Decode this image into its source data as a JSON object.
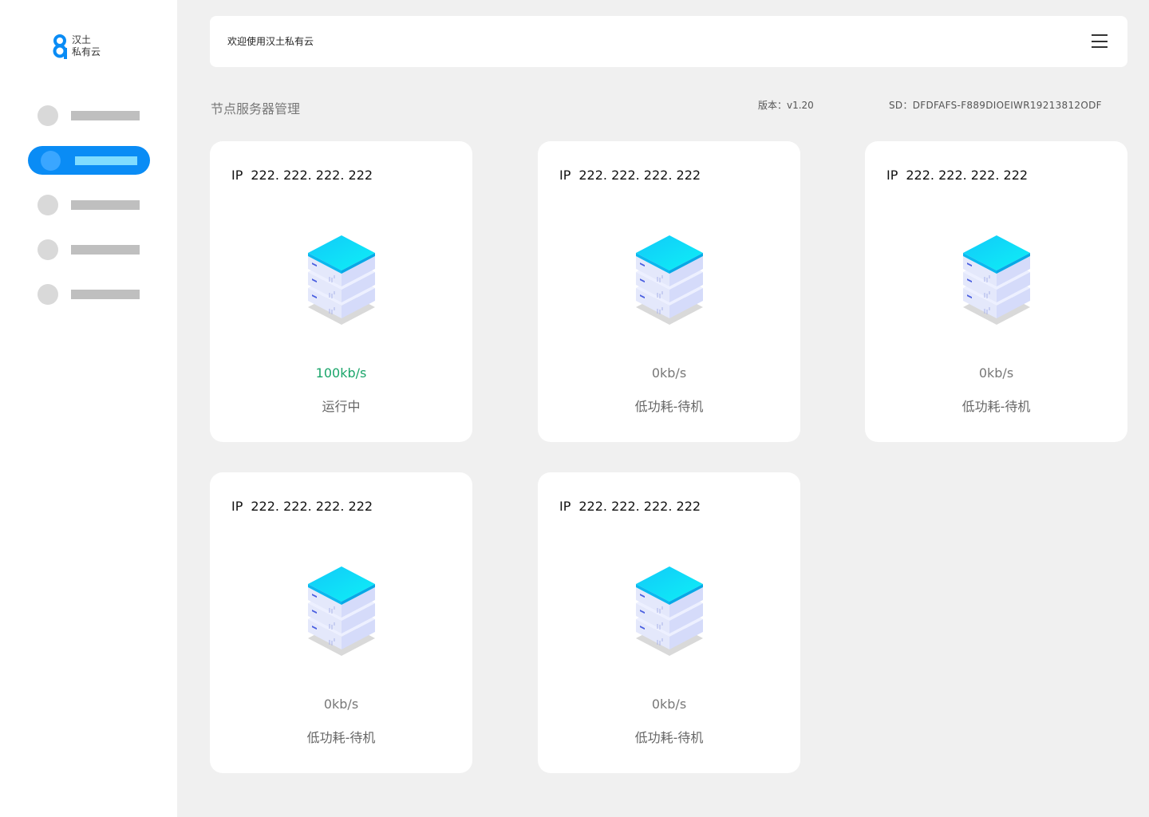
{
  "brand": {
    "line1": "汉土",
    "line2": "私有云",
    "accent": "#0a8cf5"
  },
  "header": {
    "welcome": "欢迎使用汉土私有云",
    "menu_icon": "hamburger-menu-icon"
  },
  "page": {
    "title": "节点服务器管理",
    "version": "版本：v1.20",
    "sd": "SD：DFDFAFS-F889DIOEIWR19213812ODF"
  },
  "nav": {
    "active_index": 1,
    "active_color": "#0a8cf5"
  },
  "cards": [
    {
      "ip_label": "IP",
      "ip": "222. 222. 222. 222",
      "speed": "100kb/s",
      "status": "运行中",
      "running": true
    },
    {
      "ip_label": "IP",
      "ip": "222. 222. 222. 222",
      "speed": "0kb/s",
      "status": "低功耗-待机",
      "running": false
    },
    {
      "ip_label": "IP",
      "ip": "222. 222. 222. 222",
      "speed": "0kb/s",
      "status": "低功耗-待机",
      "running": false
    },
    {
      "ip_label": "IP",
      "ip": "222. 222. 222. 222",
      "speed": "0kb/s",
      "status": "低功耗-待机",
      "running": false
    },
    {
      "ip_label": "IP",
      "ip": "222. 222. 222. 222",
      "speed": "0kb/s",
      "status": "低功耗-待机",
      "running": false
    }
  ],
  "colors": {
    "running_text": "#1aa56a",
    "server_top": "#0fd3f8",
    "server_body": "#e6eaff"
  }
}
